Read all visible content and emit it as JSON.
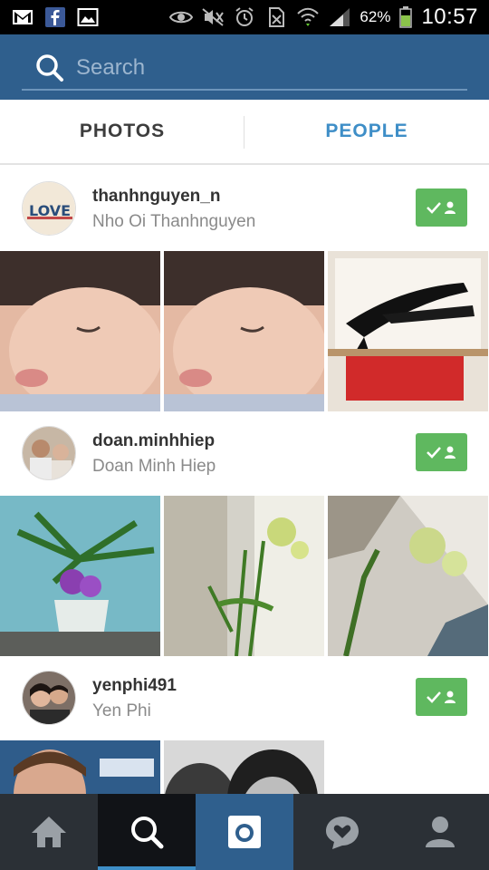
{
  "status_bar": {
    "battery_percent": "62%",
    "time": "10:57",
    "left_icons": [
      "gmail-icon",
      "facebook-icon",
      "gallery-icon"
    ],
    "right_icons": [
      "eye-icon",
      "mute-icon",
      "alarm-icon",
      "no-sim-icon",
      "wifi-icon",
      "signal-icon",
      "battery-icon"
    ]
  },
  "search": {
    "placeholder": "Search"
  },
  "tabs": [
    {
      "label": "PHOTOS",
      "active": false
    },
    {
      "label": "PEOPLE",
      "active": true
    }
  ],
  "users": [
    {
      "username": "thanhnguyen_n",
      "full_name": "Nho Oi Thanhnguyen",
      "avatar_text": "LOVE",
      "following": true
    },
    {
      "username": "doan.minhhiep",
      "full_name": "Doan Minh Hiep",
      "following": true
    },
    {
      "username": "yenphi491",
      "full_name": "Yen Phi",
      "following": true
    }
  ],
  "bottom_nav": {
    "items": [
      "home-icon",
      "search-icon",
      "camera-icon",
      "activity-icon",
      "profile-icon"
    ],
    "active": "search-icon"
  },
  "colors": {
    "header_blue": "#2f5f8d",
    "accent_blue": "#3e8ec7",
    "follow_green": "#5fb85f",
    "nav_dark": "#2b3036"
  }
}
